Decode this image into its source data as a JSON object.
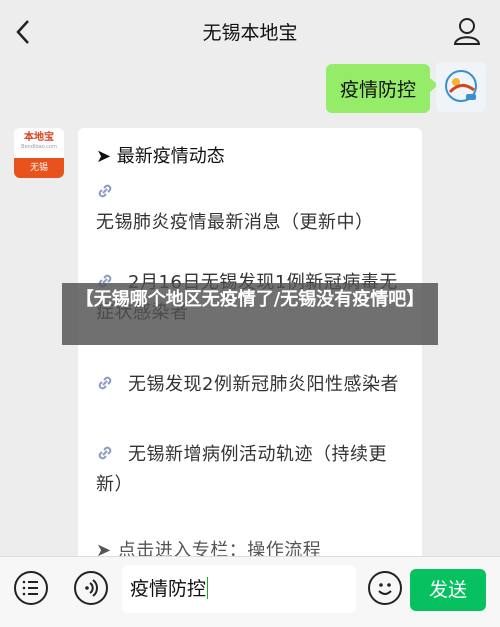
{
  "header": {
    "title": "无锡本地宝"
  },
  "chat": {
    "sent_message": "疫情防控",
    "left_avatar": {
      "brand": "本地宝",
      "sub": "Bendibao.com",
      "city": "无锡"
    },
    "card": {
      "heading": "➤ 最新疫情动态",
      "items": [
        "无锡肺炎疫情最新消息（更新中）",
        "2月16日无锡发现1例新冠病毒无症状感染者",
        "无锡发现2例新冠肺炎阳性感染者",
        "无锡新增病例活动轨迹（持续更新）",
        "➤ 点击进入专栏：操作流程"
      ]
    }
  },
  "overlay_title": "【无锡哪个地区无疫情了/无锡没有疫情吧】",
  "input_bar": {
    "value": "疫情防控",
    "send_label": "发送"
  },
  "colors": {
    "send": "#07c160",
    "bubble": "#95ec69",
    "brand": "#e8521d"
  }
}
